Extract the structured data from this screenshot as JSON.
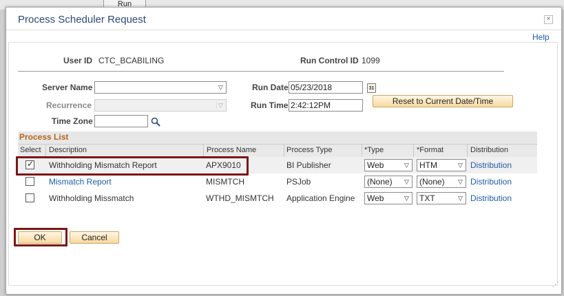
{
  "background": {
    "run_button_label": "Run"
  },
  "dialog": {
    "title": "Process Scheduler Request",
    "help_label": "Help",
    "user_id_label": "User ID",
    "user_id_value": "CTC_BCABILING",
    "run_control_id_label": "Run Control ID",
    "run_control_id_value": "1099",
    "server_name_label": "Server Name",
    "server_name_value": "",
    "recurrence_label": "Recurrence",
    "recurrence_value": "",
    "time_zone_label": "Time Zone",
    "time_zone_value": "",
    "run_date_label": "Run Date",
    "run_date_value": "05/23/2018",
    "calendar_glyph": "31",
    "run_time_label": "Run Time",
    "run_time_value": "2:42:12PM",
    "reset_button_label": "Reset to Current Date/Time",
    "ok_label": "OK",
    "cancel_label": "Cancel"
  },
  "process_list": {
    "title": "Process List",
    "columns": {
      "select": "Select",
      "description": "Description",
      "process_name": "Process Name",
      "process_type": "Process Type",
      "type": "*Type",
      "format": "*Format",
      "distribution": "Distribution"
    },
    "rows": [
      {
        "selected": true,
        "description": "Withholding Mismatch Report",
        "description_is_link": false,
        "process_name": "APX9010",
        "process_type": "BI Publisher",
        "type": "Web",
        "format": "HTM",
        "distribution": "Distribution"
      },
      {
        "selected": false,
        "description": "Mismatch Report",
        "description_is_link": true,
        "process_name": "MISMTCH",
        "process_type": "PSJob",
        "type": "(None)",
        "format": "(None)",
        "distribution": "Distribution"
      },
      {
        "selected": false,
        "description": "Withholding Missmatch",
        "description_is_link": false,
        "process_name": "WTHD_MISMTCH",
        "process_type": "Application Engine",
        "type": "Web",
        "format": "TXT",
        "distribution": "Distribution"
      }
    ]
  },
  "colors": {
    "title": "#2b4a7a",
    "link": "#1f5ba6",
    "section_title": "#b5651d",
    "highlight": "#7b1616"
  },
  "icons": {
    "close": "close-icon",
    "calendar": "calendar-icon",
    "lookup": "lookup-icon",
    "dropdown": "chevron-down-icon"
  }
}
